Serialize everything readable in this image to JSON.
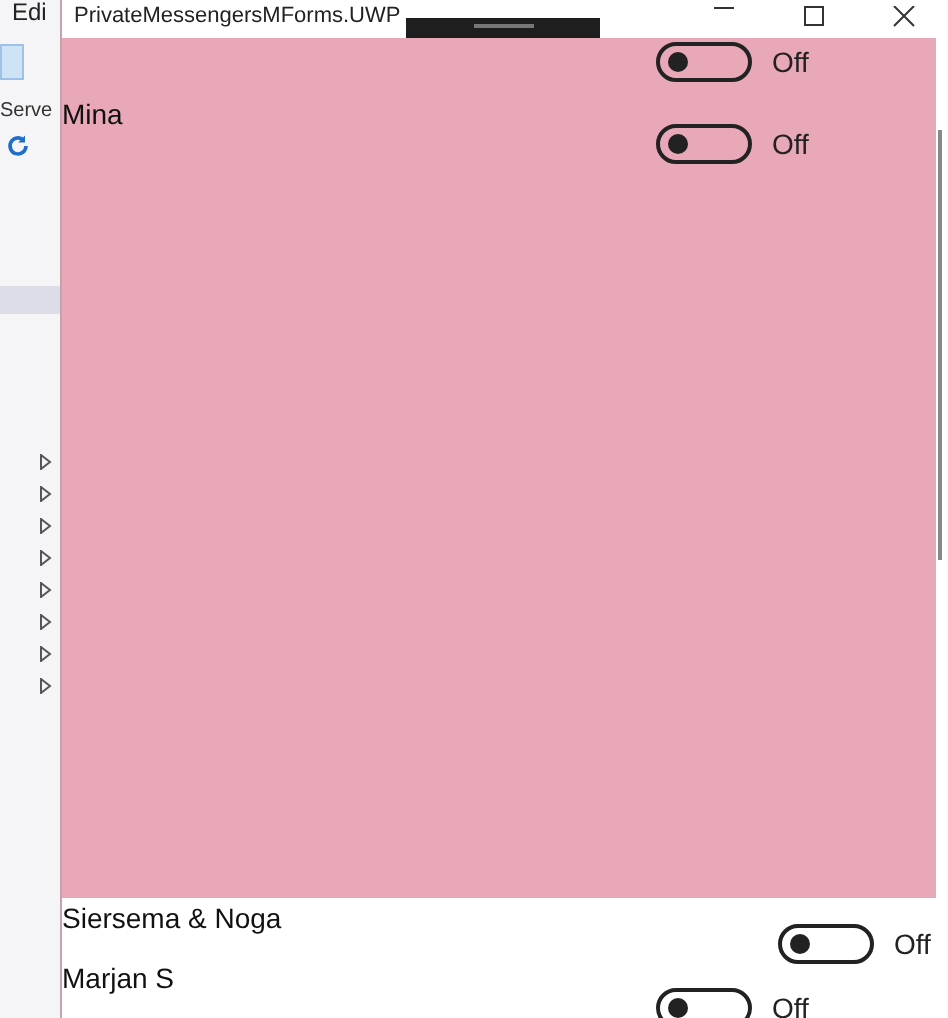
{
  "background_app": {
    "menu_label": "Edi",
    "panel_label": "Serve"
  },
  "window": {
    "title": "PrivateMessengersMForms.UWP"
  },
  "contacts": [
    {
      "selected": true,
      "on": false,
      "switch_label": "Off"
    },
    {
      "name": "Mina",
      "selected": true,
      "on": false,
      "switch_label": "Off"
    },
    {
      "name": "Siersema & Noga",
      "selected": false,
      "on": false,
      "switch_label": "Off"
    },
    {
      "name": "Marjan S",
      "selected": false,
      "on": false,
      "switch_label": "Off"
    }
  ]
}
